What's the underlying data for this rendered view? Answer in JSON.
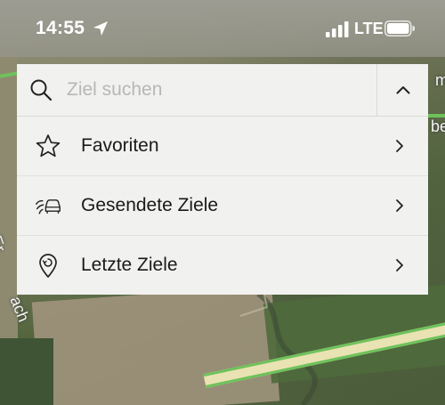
{
  "status_bar": {
    "time": "14:55",
    "network": "LTE"
  },
  "search": {
    "placeholder": "Ziel suchen"
  },
  "menu": {
    "items": [
      {
        "label": "Favoriten",
        "icon": "star-icon"
      },
      {
        "label": "Gesendete Ziele",
        "icon": "sent-car-icon"
      },
      {
        "label": "Letzte Ziele",
        "icon": "history-pin-icon"
      }
    ]
  },
  "map": {
    "labels": [
      "Er",
      "ach",
      "m",
      "bel"
    ]
  },
  "colors": {
    "panel_bg": "#f1f1ef",
    "route_green": "#6fc25b",
    "text": "#1a1a1a"
  }
}
